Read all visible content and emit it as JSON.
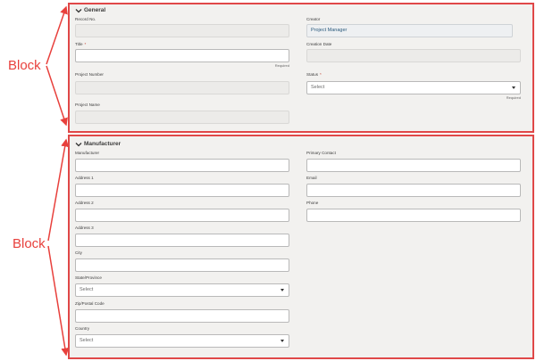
{
  "annotations": {
    "block_top": "Block",
    "block_bottom": "Block"
  },
  "general": {
    "title": "General",
    "record_no_label": "Record No.",
    "title_label": "Title",
    "title_required_mark": "*",
    "title_helper": "Required",
    "project_number_label": "Project Number",
    "project_name_label": "Project Name",
    "creator_label": "Creator",
    "creator_value": "Project Manager",
    "creation_date_label": "Creation Date",
    "status_label": "Status",
    "status_required_mark": "*",
    "status_placeholder": "Select",
    "status_helper": "Required"
  },
  "manufacturer": {
    "title": "Manufacturer",
    "manufacturer_label": "Manufacturer",
    "address1_label": "Address 1",
    "address2_label": "Address 2",
    "address3_label": "Address 3",
    "city_label": "City",
    "state_label": "State/Province",
    "state_placeholder": "Select",
    "zip_label": "Zip/Postal Code",
    "country_label": "Country",
    "country_placeholder": "Select",
    "primary_contact_label": "Primary Contact",
    "email_label": "Email",
    "phone_label": "Phone"
  },
  "colors": {
    "annotation": "#e8403c",
    "block_border": "#e04848",
    "block_bg": "#f2f1ef"
  },
  "icons": {
    "section_toggle": "chevron-down-icon",
    "select_caret": "caret-down-icon"
  }
}
